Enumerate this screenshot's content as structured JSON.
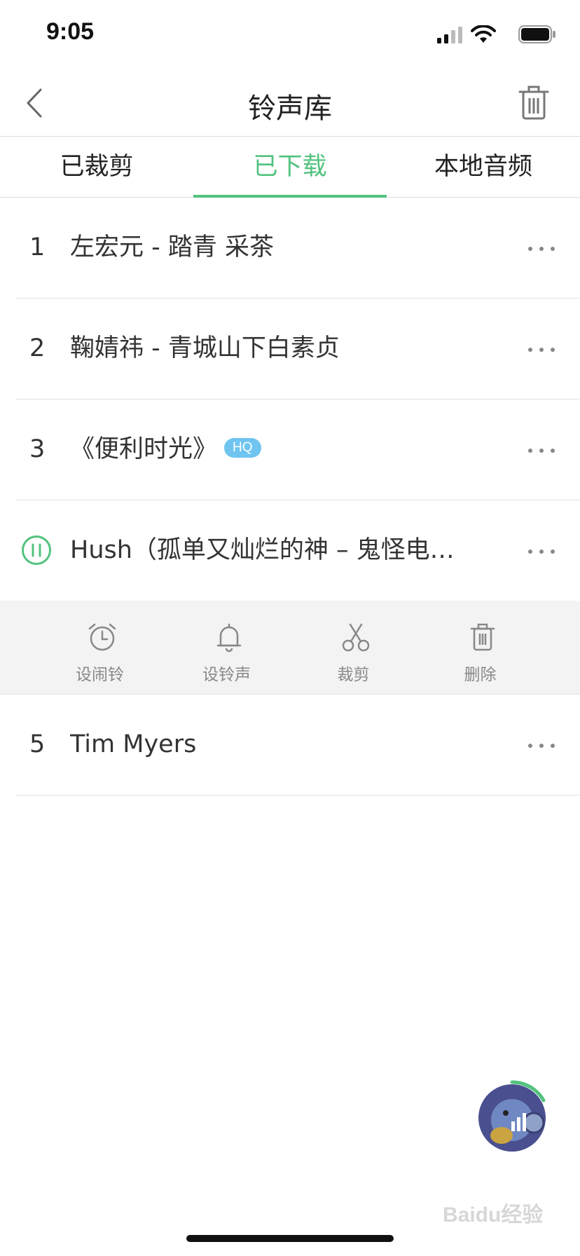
{
  "status": {
    "time": "9:05",
    "icons": [
      "signal-icon",
      "wifi-icon",
      "battery-icon"
    ]
  },
  "nav": {
    "title": "铃声库",
    "back_icon": "chevron-left-icon",
    "trash_icon": "trash-icon"
  },
  "tabs": [
    {
      "label": "已裁剪",
      "active": false
    },
    {
      "label": "已下载",
      "active": true
    },
    {
      "label": "本地音频",
      "active": false
    }
  ],
  "items": [
    {
      "index": "1",
      "title": "左宏元 - 踏青 采茶"
    },
    {
      "index": "2",
      "title": "鞠婧祎 - 青城山下白素贞"
    },
    {
      "index": "3",
      "title": "《便利时光》",
      "badge": "HQ"
    },
    {
      "index": "",
      "title": "Hush（孤单又灿烂的神 – 鬼怪电…",
      "playing": true
    },
    {
      "index": "5",
      "title": "Tim Myers"
    }
  ],
  "actions": [
    {
      "label": "设闹铃",
      "icon": "alarm-clock-icon"
    },
    {
      "label": "设铃声",
      "icon": "bell-icon"
    },
    {
      "label": "裁剪",
      "icon": "scissors-icon"
    },
    {
      "label": "删除",
      "icon": "trash-icon"
    }
  ],
  "watermark": "Baidu经验",
  "colors": {
    "accent": "#52c27e",
    "badge": "#6fc4f0",
    "panel_bg": "#f3f3f3"
  }
}
